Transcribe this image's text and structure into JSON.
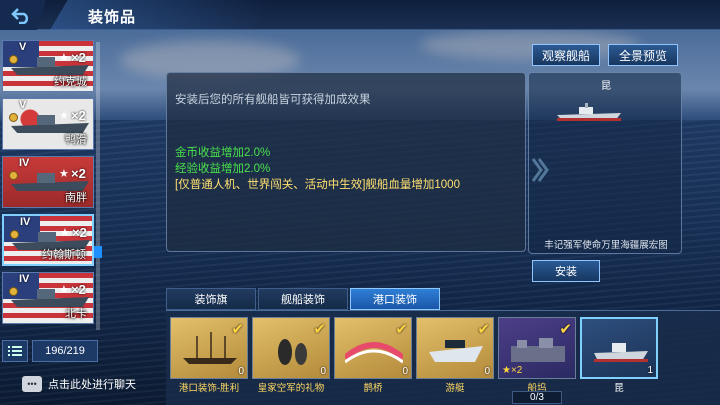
{
  "header": {
    "title": "装饰品",
    "back_icon": "back-arrow-icon"
  },
  "ship_list": [
    {
      "tier": "V",
      "multiplier": "×2",
      "name": "约克城",
      "flag": "us"
    },
    {
      "tier": "V",
      "multiplier": "×2",
      "name": "鸭滑",
      "flag": "jp"
    },
    {
      "tier": "IV",
      "multiplier": "×2",
      "name": "南胖",
      "flag": "cn"
    },
    {
      "tier": "IV",
      "multiplier": "×2",
      "name": "约翰斯顿",
      "flag": "us",
      "selected": true
    },
    {
      "tier": "IV",
      "multiplier": "×2",
      "name": "北卡",
      "flag": "us"
    }
  ],
  "list_counter": "196/219",
  "chat_hint": "点击此处进行聊天",
  "top_buttons": {
    "observe": "观察舰船",
    "panorama": "全景预览"
  },
  "info": {
    "hint": "安装后您的所有舰船皆可获得加成效果",
    "effects": [
      {
        "text": "金币收益增加2.0%",
        "color": "green"
      },
      {
        "text": "经验收益增加2.0%",
        "color": "green"
      },
      {
        "text": "[仅普通人机、世界闯关、活动中生效]舰船血量增加1000",
        "color": "yellow"
      }
    ]
  },
  "preview": {
    "name": "昆",
    "caption": "丰记强军使命万里海疆展宏图"
  },
  "install_label": "安装",
  "tabs": [
    {
      "label": "装饰旗",
      "active": false
    },
    {
      "label": "舰船装饰",
      "active": false
    },
    {
      "label": "港口装饰",
      "active": true
    }
  ],
  "items": [
    {
      "name": "港口装饰-胜利",
      "qty": "0",
      "checked": true,
      "bg": "gold"
    },
    {
      "name": "皇家空军的礼物",
      "qty": "0",
      "checked": true,
      "bg": "gold"
    },
    {
      "name": "鹊桥",
      "qty": "0",
      "checked": true,
      "bg": "gold"
    },
    {
      "name": "游艇",
      "qty": "0",
      "checked": true,
      "bg": "gold"
    },
    {
      "name": "船坞",
      "qty": "",
      "checked": true,
      "bg": "purple",
      "badge": "×2",
      "sub": "0/3"
    },
    {
      "name": "昆",
      "qty": "1",
      "checked": false,
      "bg": "blue",
      "selected": true
    }
  ]
}
